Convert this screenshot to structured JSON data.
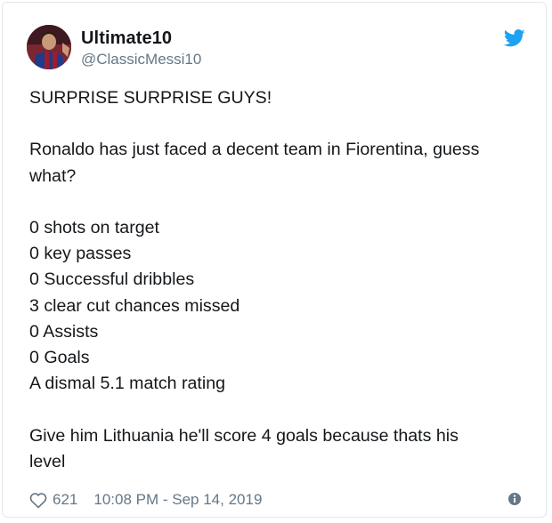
{
  "user": {
    "display_name": "Ultimate10",
    "handle": "@ClassicMessi10"
  },
  "tweet": {
    "lines": [
      "SURPRISE SURPRISE GUYS!",
      "",
      "Ronaldo has just faced a decent team in Fiorentina, guess",
      "what?",
      "",
      "0 shots on target",
      "0 key passes",
      "0 Successful dribbles",
      "3 clear cut chances missed",
      "0 Assists",
      "0 Goals",
      "A dismal 5.1 match rating",
      "",
      "Give him Lithuania he'll score 4 goals because thats his",
      "level"
    ]
  },
  "footer": {
    "like_count": "621",
    "timestamp": "10:08 PM - Sep 14, 2019"
  },
  "icons": {
    "brand": "twitter-bird-icon",
    "like": "heart-outline-icon",
    "info": "info-circle-icon"
  },
  "colors": {
    "brand_blue": "#1da1f2",
    "text": "#14171a",
    "muted": "#657786",
    "border": "#e1e8ed"
  }
}
